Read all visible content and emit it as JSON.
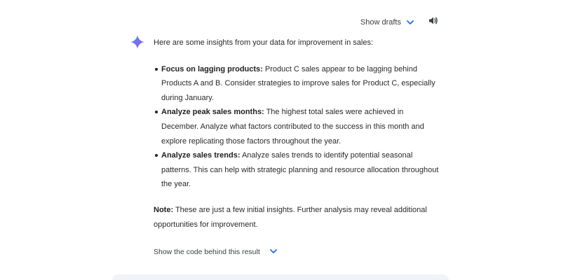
{
  "header": {
    "show_drafts_label": "Show drafts",
    "chevron_icon": "chevron-down-icon",
    "speaker_icon": "volume-icon"
  },
  "response": {
    "avatar_icon": "gemini-sparkle-icon",
    "intro": "Here are some insights from your data for improvement in sales:",
    "insights": [
      {
        "title": "Focus on lagging products:",
        "text": " Product C sales appear to be lagging behind Products A and B. Consider strategies to improve sales for Product C, especially during January."
      },
      {
        "title": "Analyze peak sales months:",
        "text": " The highest total sales were achieved in December. Analyze what factors contributed to the success in this month and explore replicating those factors throughout the year."
      },
      {
        "title": "Analyze sales trends:",
        "text": " Analyze sales trends to identify potential seasonal patterns. This can help with strategic planning and resource allocation throughout the year."
      }
    ],
    "note_label": "Note:",
    "note_text": " These are just a few initial insights. Further analysis may reveal additional opportunities for improvement.",
    "show_code_label": "Show the code behind this result"
  },
  "colors": {
    "accent": "#1a73e8",
    "text": "#1f1f1f",
    "composer_bg": "#f0f4f9"
  }
}
